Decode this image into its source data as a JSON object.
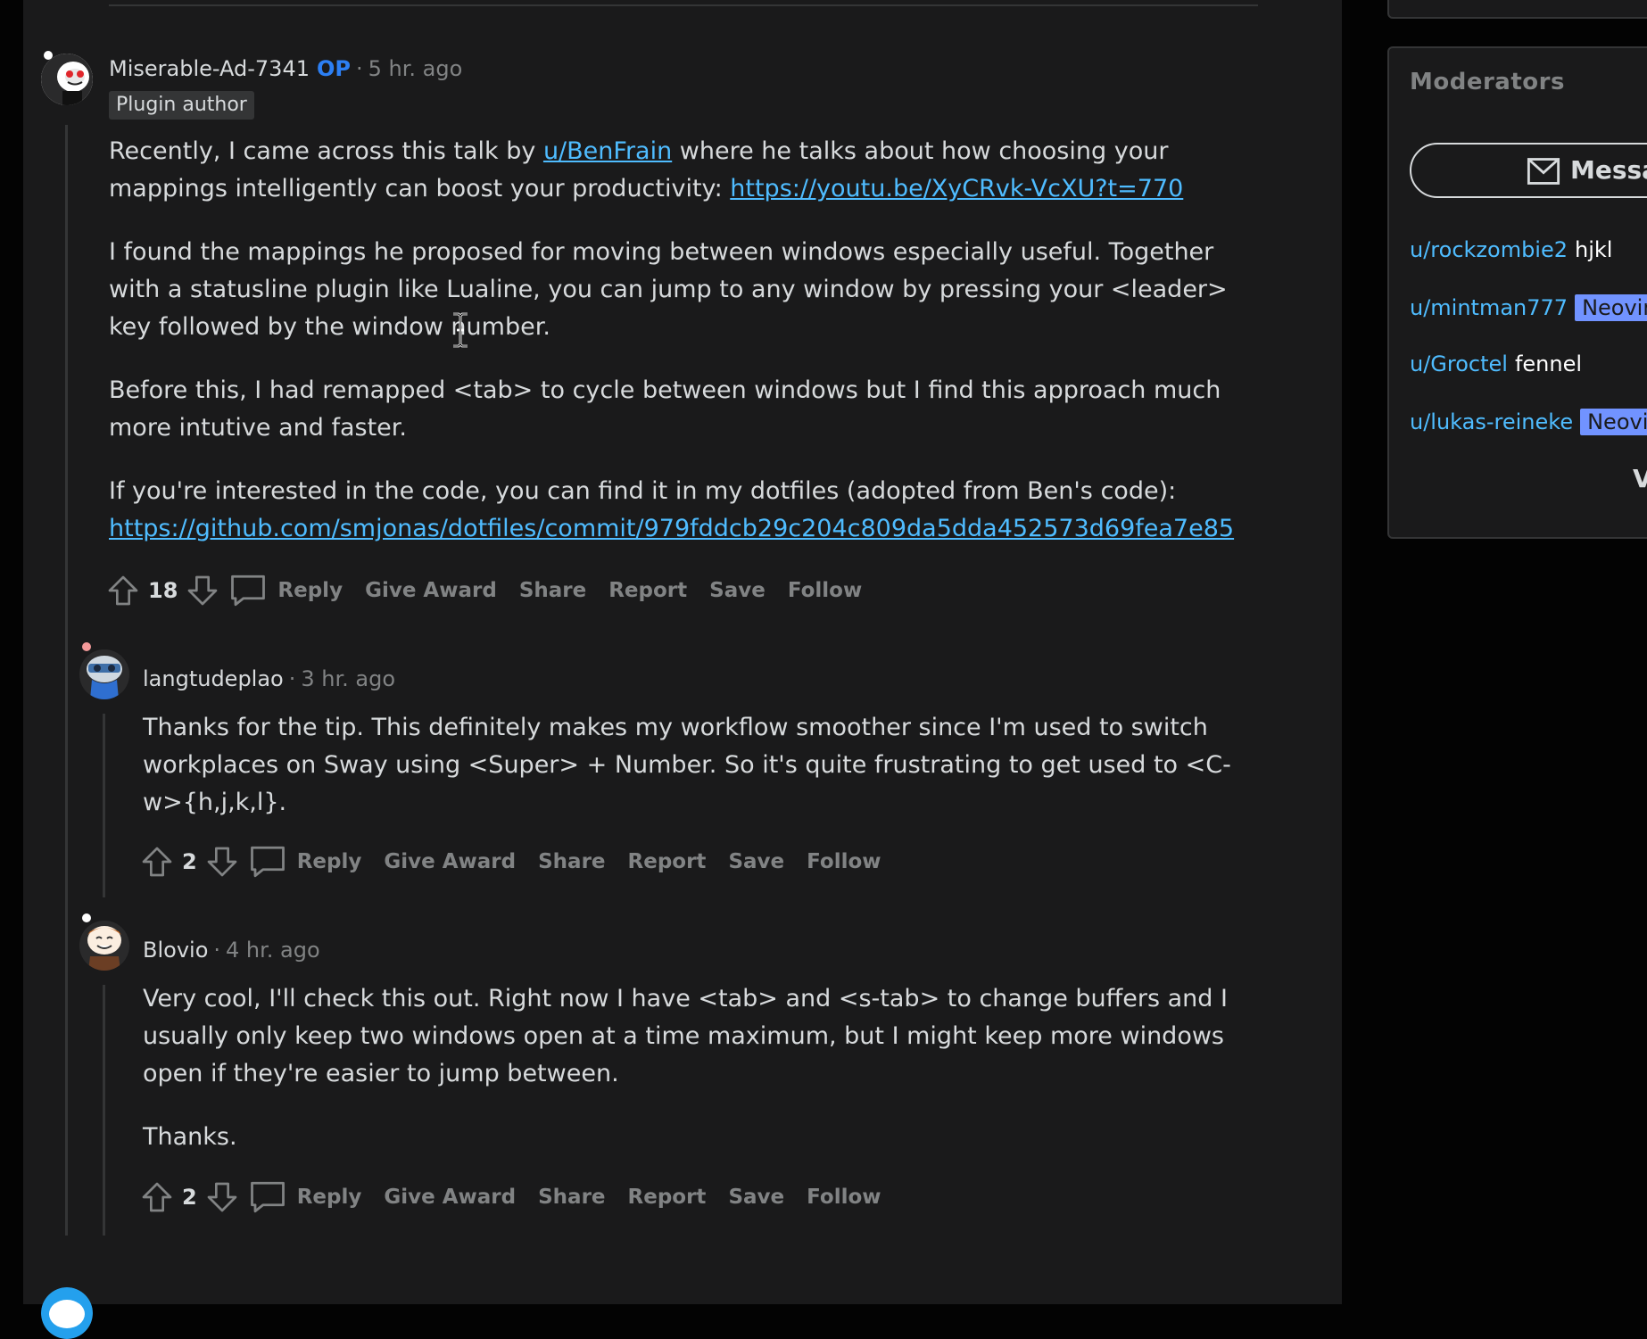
{
  "comments": [
    {
      "author": "Miserable-Ad-7341",
      "op_label": "OP",
      "time": "5 hr. ago",
      "flair": "Plugin author",
      "paragraphs": [
        {
          "t1": "Recently, I came across this talk by ",
          "link1": "u/BenFrain",
          "t2": " where he talks about how choosing your mappings intelligently can boost your productivity: ",
          "link2": "https://youtu.be/XyCRvk-VcXU?t=770"
        },
        {
          "text": "I found the mappings he proposed for moving between windows especially useful. Together with a statusline plugin like Lualine, you can jump to any window by pressing your <leader> key followed by the window number."
        },
        {
          "text": "Before this, I had remapped <tab> to cycle between windows but I find this approach much more intutive and faster."
        },
        {
          "t1": "If you're interested in the code, you can find it in my dotfiles (adopted from Ben's code): ",
          "link": "https://github.com/smjonas/dotfiles/commit/979fddcb29c204c809da5dda452573d69fea7e85"
        }
      ],
      "score": "18"
    },
    {
      "author": "langtudeplao",
      "time": "3 hr. ago",
      "paragraphs": [
        "Thanks for the tip. This definitely makes my workflow smoother since I'm used to switch workplaces on Sway using <Super> + Number. So it's quite frustrating to get used to <C-w>{h,j,k,l}."
      ],
      "score": "2"
    },
    {
      "author": "Blovio",
      "time": "4 hr. ago",
      "paragraphs": [
        "Very cool, I'll check this out. Right now I have <tab> and <s-tab> to change buffers and I usually only keep two windows open at a time maximum, but I might keep more windows open if they're easier to jump between.",
        "Thanks."
      ],
      "score": "2"
    }
  ],
  "actions": {
    "reply": "Reply",
    "give_award": "Give Award",
    "share": "Share",
    "report": "Report",
    "save": "Save",
    "follow": "Follow"
  },
  "sidebar": {
    "moderators_title": "Moderators",
    "message_button": "Messa",
    "moderators": [
      {
        "name": "u/rockzombie2",
        "flair": "hjkl",
        "flair_style": "text"
      },
      {
        "name": "u/mintman777",
        "flair": "Neovim",
        "flair_style": "badge"
      },
      {
        "name": "u/Groctel",
        "flair": "fennel",
        "flair_style": "text"
      },
      {
        "name": "u/lukas-reineke",
        "flair": "Neovim",
        "flair_style": "badge"
      }
    ],
    "view_all": "V"
  },
  "colors": {
    "background": "#030303",
    "panel": "#1a1a1b",
    "link": "#4fbcff",
    "op": "#2c7ff4",
    "muted": "#818384",
    "badge": "#7193ff"
  }
}
